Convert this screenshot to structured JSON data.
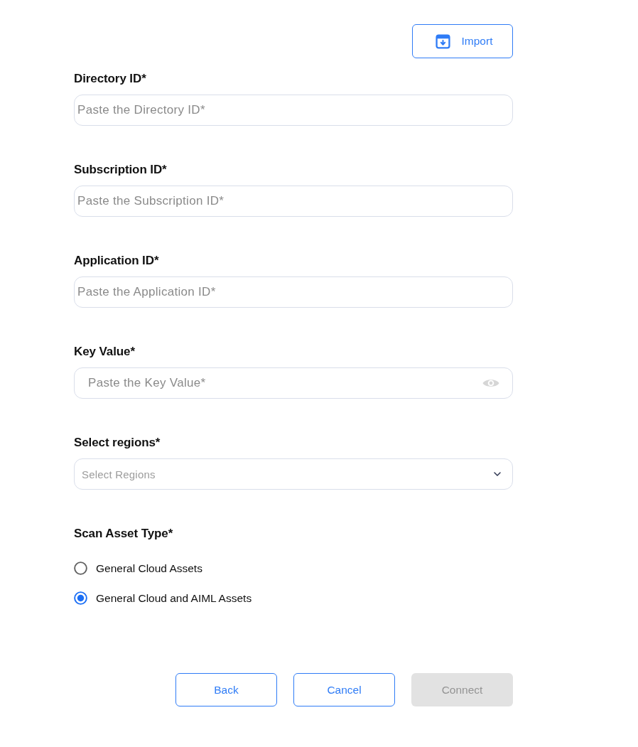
{
  "import_button": {
    "label": "Import"
  },
  "fields": [
    {
      "kind": "text",
      "label": "Directory ID*",
      "placeholder": "Paste the Directory ID*"
    },
    {
      "kind": "text",
      "label": "Subscription ID*",
      "placeholder": "Paste the Subscription ID*"
    },
    {
      "kind": "text",
      "label": "Application ID*",
      "placeholder": "Paste the Application ID*"
    },
    {
      "kind": "password",
      "label": "Key Value*",
      "placeholder": "Paste the Key Value*"
    },
    {
      "kind": "select",
      "label": "Select regions*",
      "placeholder": "Select Regions"
    }
  ],
  "scan_asset_type": {
    "label": "Scan Asset Type*",
    "options": [
      {
        "label": "General Cloud Assets",
        "selected": false
      },
      {
        "label": "General Cloud and AIML Assets",
        "selected": true
      }
    ]
  },
  "buttons": [
    {
      "label": "Back",
      "disabled": false
    },
    {
      "label": "Cancel",
      "disabled": false
    },
    {
      "label": "Connect",
      "disabled": true
    }
  ]
}
